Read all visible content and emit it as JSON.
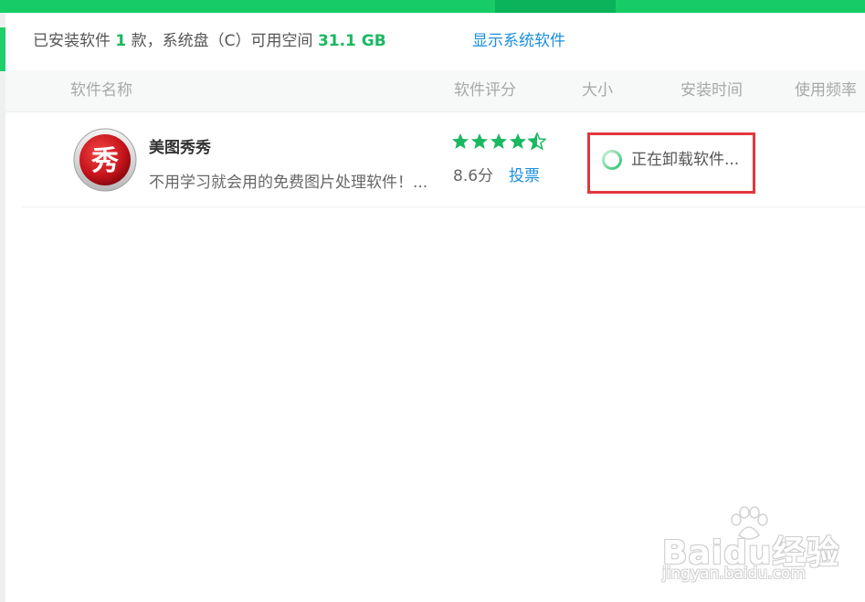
{
  "summary": {
    "prefix": "已安装软件",
    "count": "1",
    "middle": "款，系统盘（C）可用空间",
    "free_space": "31.1 GB",
    "show_system_link": "显示系统软件"
  },
  "columns": {
    "name": "软件名称",
    "rating": "软件评分",
    "size": "大小",
    "install_time": "安装时间",
    "frequency": "使用频率"
  },
  "apps": [
    {
      "name": "美图秀秀",
      "description": "不用学习就会用的免费图片处理软件！...",
      "stars": 4.5,
      "score": "8.6分",
      "vote_label": "投票",
      "status": "正在卸载软件...",
      "icon_char": "秀"
    }
  ],
  "watermark": {
    "logo": "Baidu经验",
    "url": "jingyan.baidu.com"
  },
  "colors": {
    "accent_green": "#17cc66",
    "link_blue": "#1a8fdf",
    "highlight_red": "#e2373d",
    "star_green": "#19b861"
  }
}
